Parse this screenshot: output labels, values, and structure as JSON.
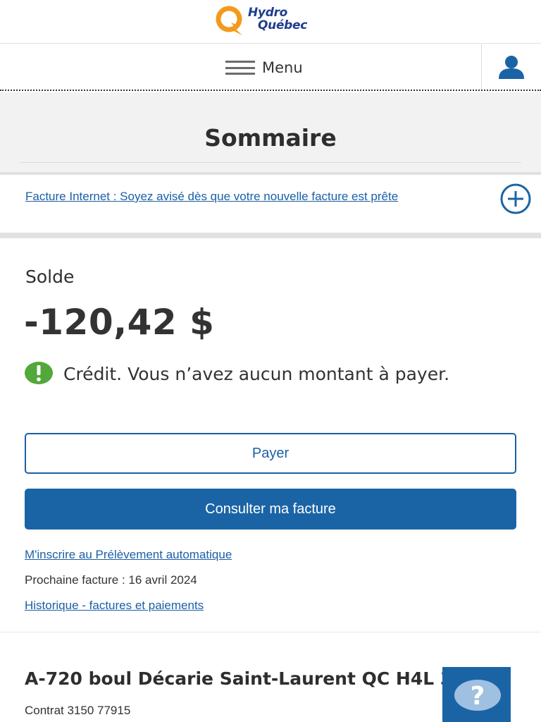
{
  "header": {
    "logo_line1": "Hydro",
    "logo_line2": "Québec",
    "menu_label": "Menu"
  },
  "page": {
    "title": "Sommaire"
  },
  "notice": {
    "link_text": "Facture Internet : Soyez avisé dès que votre nouvelle facture est prête"
  },
  "balance": {
    "label": "Solde",
    "amount": "-120,42 $",
    "status_text": "Crédit. Vous n’avez aucun montant à payer.",
    "pay_button": "Payer",
    "view_bill_button": "Consulter ma facture",
    "autopay_link": "M'inscrire au Prélèvement automatique",
    "next_bill": "Prochaine facture : 16 avril 2024",
    "history_link": "Historique - factures et paiements"
  },
  "account": {
    "address": "A-720 boul Décarie Saint-Laurent QC H4L 3L6",
    "contract": "Contrat 3150 77915"
  },
  "icons": {
    "logo": "hydro-quebec-logo",
    "menu": "hamburger-icon",
    "user": "user-icon",
    "expand": "plus-circle-icon",
    "status": "exclamation-circle-icon",
    "help": "question-icon"
  },
  "colors": {
    "brand_blue": "#1a64a6",
    "link_blue": "#1b5fa6",
    "logo_orange": "#f39a1e",
    "logo_navy": "#1d3d8f",
    "status_green": "#52a83a"
  }
}
